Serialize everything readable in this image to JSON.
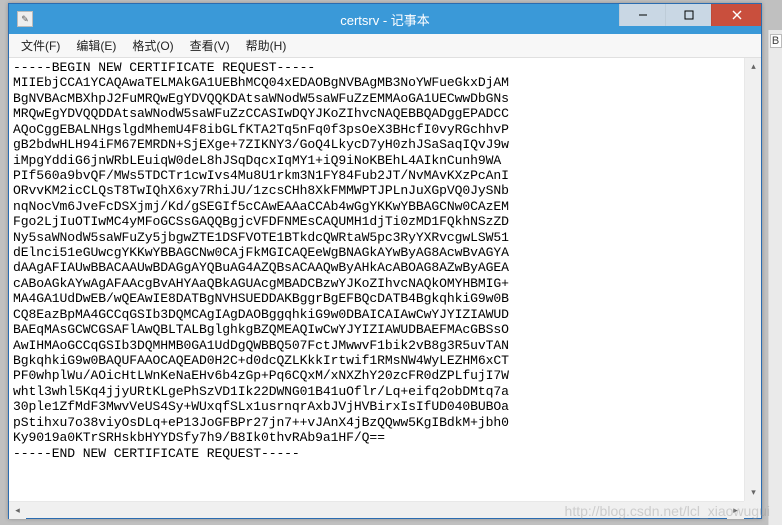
{
  "window": {
    "title": "certsrv - 记事本"
  },
  "menu": {
    "file": "文件(F)",
    "edit": "编辑(E)",
    "format": "格式(O)",
    "view": "查看(V)",
    "help": "帮助(H)"
  },
  "rightTag": "B",
  "watermark": "http://blog.csdn.net/lcl_xiaowugui",
  "content": "-----BEGIN NEW CERTIFICATE REQUEST-----\nMIIEbjCCA1YCAQAwaTELMAkGA1UEBhMCQ04xEDAOBgNVBAgMB3NoYWFueGkxDjAM\nBgNVBAcMBXhpJ2FuMRQwEgYDVQQKDAtsaWNodW5saWFuZzEMMAoGA1UECwwDbGNs\nMRQwEgYDVQQDDAtsaWNodW5saWFuZzCCASIwDQYJKoZIhvcNAQEBBQADggEPADCC\nAQoCggEBALNHgslgdMhemU4F8ibGLfKTA2Tq5nFq0f3psOeX3BHcfI0vyRGchhvP\ngB2bdwHLH94iFM67EMRDN+SjEXge+7ZIKNY3/GoQ4LkycD7yH0zhJSaSaqIQvJ9w\niMpgYddiG6jnWRbLEuiqW0deL8hJSqDqcxIqMY1+iQ9iNoKBEhL4AIknCunh9WA\nPIf560a9bvQF/MWs5TDCTr1cwIvs4Mu8U1rkm3N1FY84Fub2JT/NvMAvKXzPcAnI\nORvvKM2icCLQsT8TwIQhX6xy7RhiJU/1zcsCHh8XkFMMWPTJPLnJuXGpVQ0JySNb\nnqNocVm6JveFcDSXjmj/Kd/gSEGIf5cCAwEAAaCCAb4wGgYKKwYBBAGCNw0CAzEM\nFgo2LjIuOTIwMC4yMFoGCSsGAQQBgjcVFDFNMEsCAQUMH1djTi0zMD1FQkhNSzZD\nNy5saWNodW5saWFuZy5jbgwZTE1DSFVOTE1BTkdcQWRtaW5pc3RyYXRvcgwLSW51\ndElnci51eGUwcgYKKwYBBAGCNw0CAjFkMGICAQEeWgBNAGkAYwByAG8AcwBvAGYA\ndAAgAFIAUwBBACAAUwBDAGgAYQBuAG4AZQBsACAAQwByAHkAcABOAG8AZwByAGEA\ncABoAGkAYwAgAFAAcgBvAHYAaQBkAGUAcgMBADCBzwYJKoZIhvcNAQkOMYHBMIG+\nMA4GA1UdDwEB/wQEAwIE8DATBgNVHSUEDDAKBggrBgEFBQcDATB4BgkqhkiG9w0B\nCQ8EazBpMA4GCCqGSIb3DQMCAgIAgDAOBggqhkiG9w0DBAICAIAwCwYJYIZIAWUD\nBAEqMAsGCWCGSAFlAwQBLTALBglghkgBZQMEAQIwCwYJYIZIAWUDBAEFMAcGBSsO\nAwIHMAoGCCqGSIb3DQMHMB0GA1UdDgQWBBQ507FctJMwwvF1bik2vB8g3R5uvTAN\nBgkqhkiG9w0BAQUFAAOCAQEAD0H2C+d0dcQZLKkkIrtwif1RMsNW4WyLEZHM6xCT\nPF0whplWu/AOicHtLWnKeNaEHv6b4zGp+Pq6CQxM/xNXZhY20zcFR0dZPLfujI7W\nwhtl3whl5Kq4jjyURtKLgePhSzVD1Ik22DWNG01B41uOflr/Lq+eifq2obDMtq7a\n30ple1ZfMdF3MwvVeUS4Sy+WUxqfSLx1usrnqrAxbJVjHVBirxIsIfUD040BUBOa\npStihxu7o38viyOsDLq+eP13JoGFBPr27jn7++vJAnX4jBzQQww5KgIBdkM+jbh0\nKy9019a0KTrSRHskbHYYDSfy7h9/B8Ik0thvRAb9a1HF/Q==\n-----END NEW CERTIFICATE REQUEST-----\n"
}
